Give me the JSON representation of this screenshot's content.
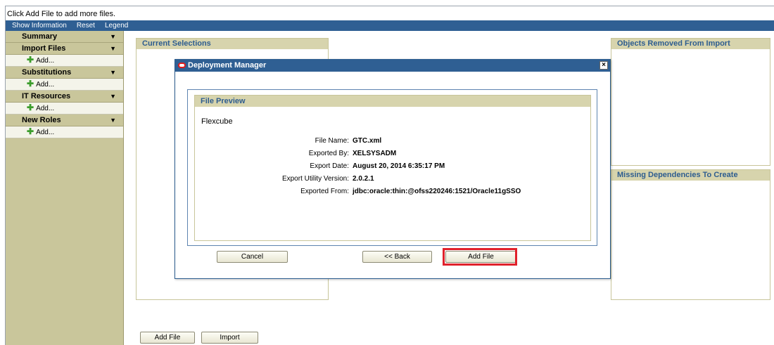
{
  "hint_text": "Click Add File to add more files.",
  "topbar": {
    "items": [
      "Show Information",
      "Reset",
      "Legend"
    ]
  },
  "sidebar": {
    "sections": [
      {
        "title": "Summary",
        "items": []
      },
      {
        "title": "Import Files",
        "items": [
          "Add..."
        ]
      },
      {
        "title": "Substitutions",
        "items": [
          "Add..."
        ]
      },
      {
        "title": "IT Resources",
        "items": [
          "Add..."
        ]
      },
      {
        "title": "New Roles",
        "items": [
          "Add..."
        ]
      }
    ],
    "arrow": "▼"
  },
  "panels": {
    "current_selections": "Current Selections",
    "objects_removed": "Objects Removed From Import",
    "missing_dependencies": "Missing Dependencies To Create"
  },
  "bottom_buttons": {
    "add_file": "Add File",
    "import": "Import"
  },
  "dialog": {
    "title": "Deployment Manager",
    "close": "×",
    "preview_title": "File Preview",
    "preview_name": "Flexcube",
    "fields": [
      {
        "label": "File Name:",
        "value": "GTC.xml"
      },
      {
        "label": "Exported By:",
        "value": "XELSYSADM"
      },
      {
        "label": "Export Date:",
        "value": "August 20, 2014 6:35:17 PM"
      },
      {
        "label": "Export Utility Version:",
        "value": "2.0.2.1"
      },
      {
        "label": "Exported From:",
        "value": "jdbc:oracle:thin:@ofss220246:1521/Oracle11gSSO"
      }
    ],
    "buttons": {
      "cancel": "Cancel",
      "back": "<< Back",
      "add_file": "Add File"
    }
  },
  "colors": {
    "bar_blue": "#2f5f93",
    "sidebar_olive": "#c9c69b",
    "panel_header": "#d7d4ad",
    "highlight_red": "#e0212b"
  }
}
